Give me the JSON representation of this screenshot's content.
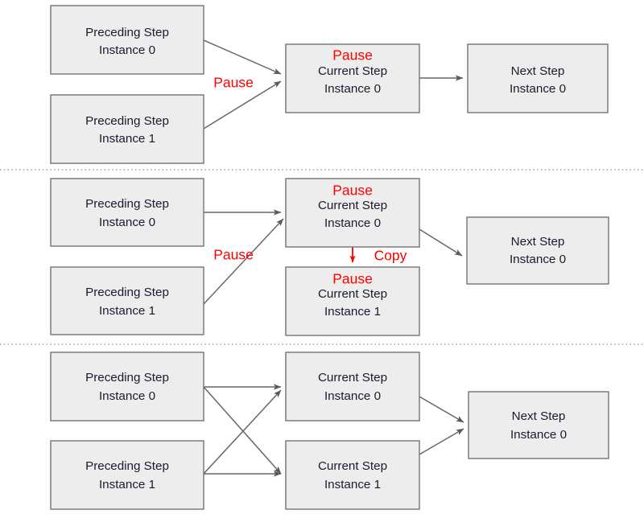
{
  "diagram": {
    "title": "Step instance pause and copy propagation diagram",
    "colors": {
      "box_fill": "#ededed",
      "box_stroke": "#737373",
      "text": "#1a1a2e",
      "accent_red": "#ff0000",
      "arrow": "#666666",
      "divider": "#9a9a9a",
      "background": "#ffffff"
    },
    "panels": [
      {
        "id": "panel-1",
        "nodes": [
          {
            "id": "p1-prec-0",
            "kind": "preceding-step",
            "lines": [
              "Preceding Step",
              "Instance 0"
            ],
            "pause": ""
          },
          {
            "id": "p1-prec-1",
            "kind": "preceding-step",
            "lines": [
              "Preceding Step",
              "Instance 1"
            ],
            "pause": ""
          },
          {
            "id": "p1-curr-0",
            "kind": "current-step",
            "lines": [
              "Current Step",
              "Instance 0"
            ],
            "pause": "Pause"
          },
          {
            "id": "p1-next-0",
            "kind": "next-step",
            "lines": [
              "Next Step",
              "Instance 0"
            ],
            "pause": ""
          }
        ],
        "edges": [
          {
            "id": "p1-e1",
            "from": "p1-prec-0",
            "to": "p1-curr-0",
            "label": ""
          },
          {
            "id": "p1-e2",
            "from": "p1-prec-1",
            "to": "p1-curr-0",
            "label": ""
          },
          {
            "id": "p1-e3",
            "from": "p1-curr-0",
            "to": "p1-next-0",
            "label": ""
          }
        ],
        "labels": [
          {
            "id": "p1-pause-label",
            "text": "Pause"
          }
        ]
      },
      {
        "id": "panel-2",
        "nodes": [
          {
            "id": "p2-prec-0",
            "kind": "preceding-step",
            "lines": [
              "Preceding Step",
              "Instance 0"
            ],
            "pause": ""
          },
          {
            "id": "p2-prec-1",
            "kind": "preceding-step",
            "lines": [
              "Preceding Step",
              "Instance 1"
            ],
            "pause": ""
          },
          {
            "id": "p2-curr-0",
            "kind": "current-step",
            "lines": [
              "Current Step",
              "Instance 0"
            ],
            "pause": "Pause"
          },
          {
            "id": "p2-curr-1",
            "kind": "current-step",
            "lines": [
              "Current Step",
              "Instance 1"
            ],
            "pause": "Pause"
          },
          {
            "id": "p2-next-0",
            "kind": "next-step",
            "lines": [
              "Next Step",
              "Instance 0"
            ],
            "pause": ""
          }
        ],
        "edges": [
          {
            "id": "p2-e1",
            "from": "p2-prec-0",
            "to": "p2-curr-0",
            "label": ""
          },
          {
            "id": "p2-e2",
            "from": "p2-prec-1",
            "to": "p2-curr-0",
            "label": ""
          },
          {
            "id": "p2-e3",
            "from": "p2-curr-0",
            "to": "p2-next-0",
            "label": ""
          },
          {
            "id": "p2-e4",
            "from": "p2-curr-0",
            "to": "p2-curr-1",
            "label": "Copy"
          }
        ],
        "labels": [
          {
            "id": "p2-pause-label",
            "text": "Pause"
          },
          {
            "id": "p2-copy-label",
            "text": "Copy"
          }
        ]
      },
      {
        "id": "panel-3",
        "nodes": [
          {
            "id": "p3-prec-0",
            "kind": "preceding-step",
            "lines": [
              "Preceding Step",
              "Instance 0"
            ],
            "pause": ""
          },
          {
            "id": "p3-prec-1",
            "kind": "preceding-step",
            "lines": [
              "Preceding Step",
              "Instance 1"
            ],
            "pause": ""
          },
          {
            "id": "p3-curr-0",
            "kind": "current-step",
            "lines": [
              "Current Step",
              "Instance 0"
            ],
            "pause": ""
          },
          {
            "id": "p3-curr-1",
            "kind": "current-step",
            "lines": [
              "Current Step",
              "Instance 1"
            ],
            "pause": ""
          },
          {
            "id": "p3-next-0",
            "kind": "next-step",
            "lines": [
              "Next Step",
              "Instance 0"
            ],
            "pause": ""
          }
        ],
        "edges": [
          {
            "id": "p3-e1",
            "from": "p3-prec-0",
            "to": "p3-curr-0",
            "label": ""
          },
          {
            "id": "p3-e2",
            "from": "p3-prec-0",
            "to": "p3-curr-1",
            "label": ""
          },
          {
            "id": "p3-e3",
            "from": "p3-prec-1",
            "to": "p3-curr-0",
            "label": ""
          },
          {
            "id": "p3-e4",
            "from": "p3-prec-1",
            "to": "p3-curr-1",
            "label": ""
          },
          {
            "id": "p3-e5",
            "from": "p3-curr-0",
            "to": "p3-next-0",
            "label": ""
          },
          {
            "id": "p3-e6",
            "from": "p3-curr-1",
            "to": "p3-next-0",
            "label": ""
          }
        ],
        "labels": []
      }
    ]
  }
}
